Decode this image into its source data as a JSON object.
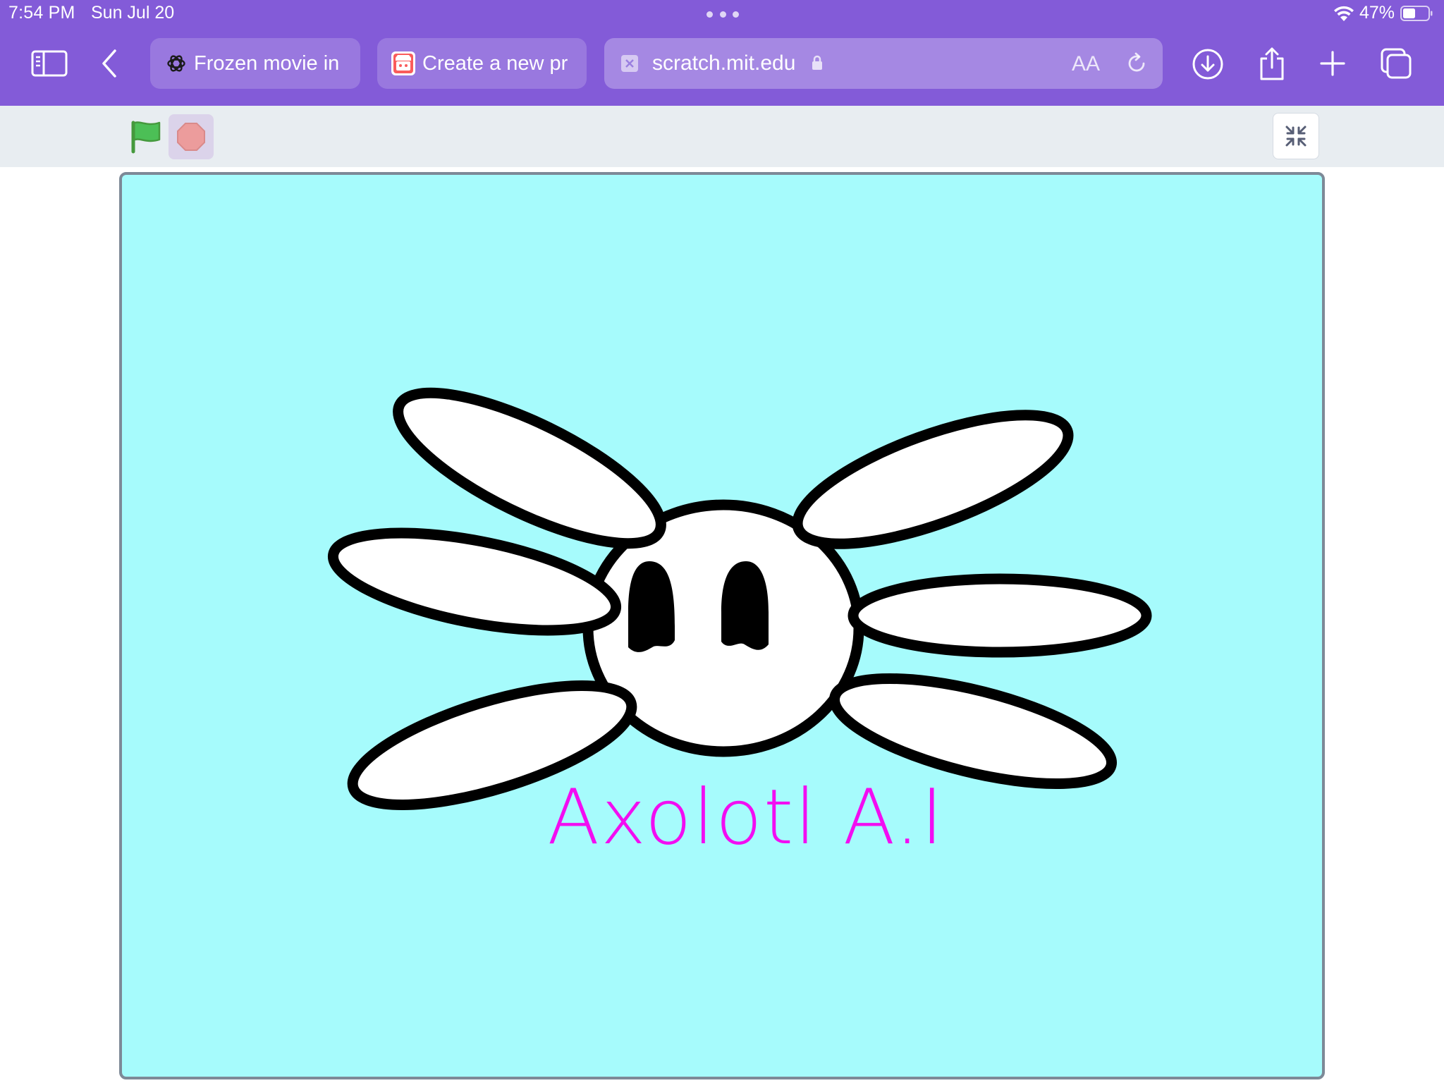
{
  "status_bar": {
    "time": "7:54 PM",
    "date": "Sun Jul 20",
    "battery": "47%"
  },
  "browser": {
    "tabs": [
      {
        "title": "Frozen movie in",
        "icon": "chatgpt-icon"
      },
      {
        "title": "Create a new pr",
        "icon": "itch-io-icon"
      }
    ],
    "address": {
      "url": "scratch.mit.edu",
      "text_size_label": "AA",
      "secure": true
    },
    "toolbar_icons": [
      "sidebar-icon",
      "back-icon",
      "download-icon",
      "share-icon",
      "new-tab-icon",
      "tabs-overview-icon"
    ]
  },
  "player": {
    "controls": [
      "green-flag-icon",
      "stop-sign-icon",
      "unfullscreen-icon"
    ],
    "stage": {
      "background_color": "#a6fbfc",
      "title": "Axolotl A.I",
      "title_color": "#f20df1",
      "sprite": "axolotl-logo"
    }
  },
  "colors": {
    "browser_chrome": "#835bd8",
    "controls_bar": "#e8edf1",
    "stage_border": "#7d8997"
  }
}
